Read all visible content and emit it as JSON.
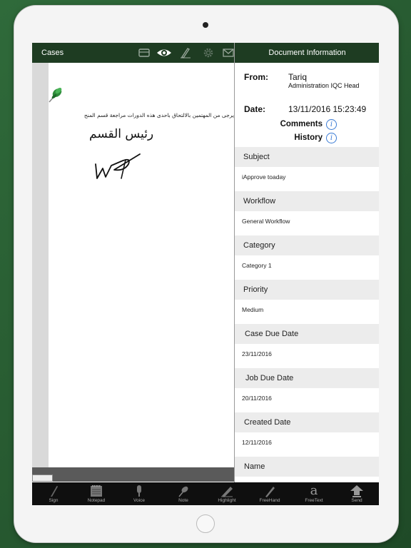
{
  "topbar": {
    "cases_label": "Cases"
  },
  "panel": {
    "header_title": "Document Information",
    "from_label": "From:",
    "from_name": "Tariq",
    "from_role": "Administration IQC Head",
    "date_label": "Date:",
    "date_value": "13/11/2016 15:23:49",
    "comments_label": "Comments",
    "history_label": "History",
    "fields": [
      {
        "label": "Subject",
        "value": "iApprove toaday"
      },
      {
        "label": "Workflow",
        "value": "General Workflow"
      },
      {
        "label": "Category",
        "value": "Category 1"
      },
      {
        "label": "Priority",
        "value": "Medium"
      },
      {
        "label": "Case Due Date",
        "value": "23/11/2016"
      },
      {
        "label": "Job Due Date",
        "value": "20/11/2016"
      },
      {
        "label": "Created Date",
        "value": "12/11/2016"
      },
      {
        "label": "Name",
        "value": ""
      }
    ]
  },
  "document": {
    "arabic_line": "يرجى من المهتمين بالالتحاق باحدى هذه الدورات مراجعة قسم المنح",
    "arabic_title": "رئيس القسم"
  },
  "toolbar": [
    {
      "label": "Sign",
      "icon": "pen-icon"
    },
    {
      "label": "Notepad",
      "icon": "notepad-icon"
    },
    {
      "label": "Voice",
      "icon": "microphone-icon"
    },
    {
      "label": "Note",
      "icon": "pin-icon"
    },
    {
      "label": "Highlight",
      "icon": "highlighter-icon"
    },
    {
      "label": "FreeHand",
      "icon": "pencil-icon"
    },
    {
      "label": "FreeText",
      "icon": "text-a-icon"
    },
    {
      "label": "Send",
      "icon": "upload-arrow-icon"
    }
  ],
  "colors": {
    "bar": "#1e3c22",
    "background": "#2a5a32",
    "info": "#3a7bd5"
  }
}
